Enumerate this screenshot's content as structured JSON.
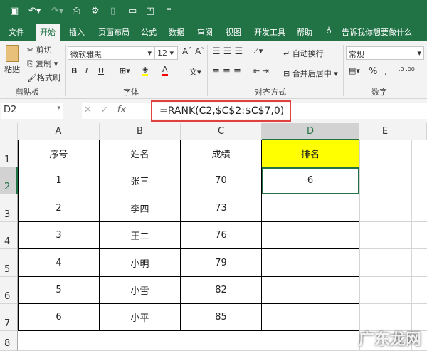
{
  "quick_access": [
    "save-icon",
    "undo-icon",
    "redo-icon",
    "print-preview-icon",
    "macro-icon",
    "clipboard-icon",
    "comment-icon",
    "comment-settings-icon",
    "customize-icon"
  ],
  "tabs": [
    "文件",
    "开始",
    "插入",
    "页面布局",
    "公式",
    "数据",
    "审阅",
    "视图",
    "开发工具",
    "帮助"
  ],
  "active_tab": "开始",
  "tell_me": "告诉我你想要做什么",
  "clipboard": {
    "paste": "粘贴",
    "cut": "剪切",
    "copy": "复制",
    "format_painter": "格式刷",
    "group": "剪贴板"
  },
  "font": {
    "name": "微软雅黑",
    "size": "12",
    "bold": "B",
    "italic": "I",
    "underline": "U",
    "group": "字体",
    "highlight_color": "#ffff00",
    "font_color": "#ff0000"
  },
  "alignment": {
    "wrap": "自动换行",
    "merge": "合并后居中",
    "group": "对齐方式"
  },
  "number": {
    "format": "常规",
    "percent": "%",
    "comma": ",",
    "group": "数字"
  },
  "name_box": "D2",
  "formula": "=RANK(C2,$C$2:$C$7,0)",
  "columns": [
    "A",
    "B",
    "C",
    "D",
    "E"
  ],
  "rows": [
    "1",
    "2",
    "3",
    "4",
    "5",
    "6",
    "7",
    "8"
  ],
  "table": {
    "headers": [
      "序号",
      "姓名",
      "成绩",
      "排名"
    ],
    "data": [
      [
        "1",
        "张三",
        "70",
        "6"
      ],
      [
        "2",
        "李四",
        "73",
        ""
      ],
      [
        "3",
        "王二",
        "76",
        ""
      ],
      [
        "4",
        "小明",
        "79",
        ""
      ],
      [
        "5",
        "小雪",
        "82",
        ""
      ],
      [
        "6",
        "小平",
        "85",
        ""
      ]
    ]
  },
  "header_highlight": "#ffff00",
  "watermark": "广东龙网"
}
